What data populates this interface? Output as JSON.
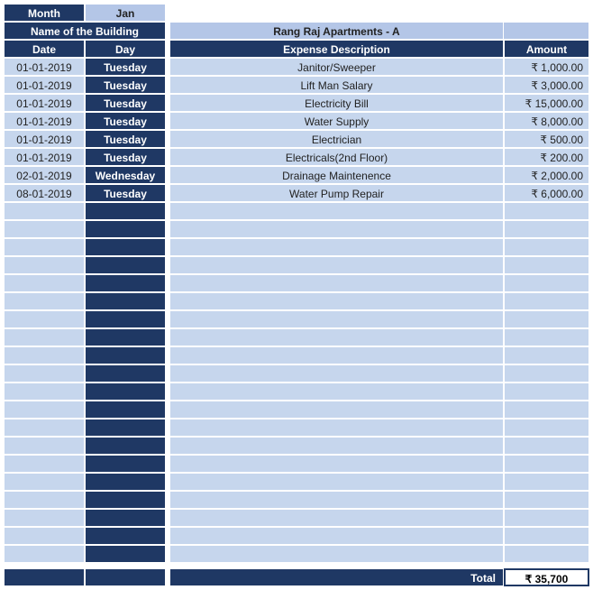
{
  "header": {
    "month_label": "Month",
    "month_value": "Jan",
    "building_label": "Name of the Building",
    "building_value": "Rang Raj Apartments - A",
    "col_date": "Date",
    "col_day": "Day",
    "col_desc": "Expense Description",
    "col_amount": "Amount"
  },
  "rows": [
    {
      "date": "01-01-2019",
      "day": "Tuesday",
      "desc": "Janitor/Sweeper",
      "amount": "₹ 1,000.00"
    },
    {
      "date": "01-01-2019",
      "day": "Tuesday",
      "desc": "Lift Man Salary",
      "amount": "₹ 3,000.00"
    },
    {
      "date": "01-01-2019",
      "day": "Tuesday",
      "desc": "Electricity Bill",
      "amount": "₹ 15,000.00"
    },
    {
      "date": "01-01-2019",
      "day": "Tuesday",
      "desc": "Water Supply",
      "amount": "₹ 8,000.00"
    },
    {
      "date": "01-01-2019",
      "day": "Tuesday",
      "desc": "Electrician",
      "amount": "₹ 500.00"
    },
    {
      "date": "01-01-2019",
      "day": "Tuesday",
      "desc": "Electricals(2nd Floor)",
      "amount": "₹ 200.00"
    },
    {
      "date": "02-01-2019",
      "day": "Wednesday",
      "desc": "Drainage Maintenence",
      "amount": "₹ 2,000.00"
    },
    {
      "date": "08-01-2019",
      "day": "Tuesday",
      "desc": "Water Pump Repair",
      "amount": "₹ 6,000.00"
    }
  ],
  "empty_row_count": 20,
  "footer": {
    "total_label": "Total",
    "total_value": "₹ 35,700"
  }
}
